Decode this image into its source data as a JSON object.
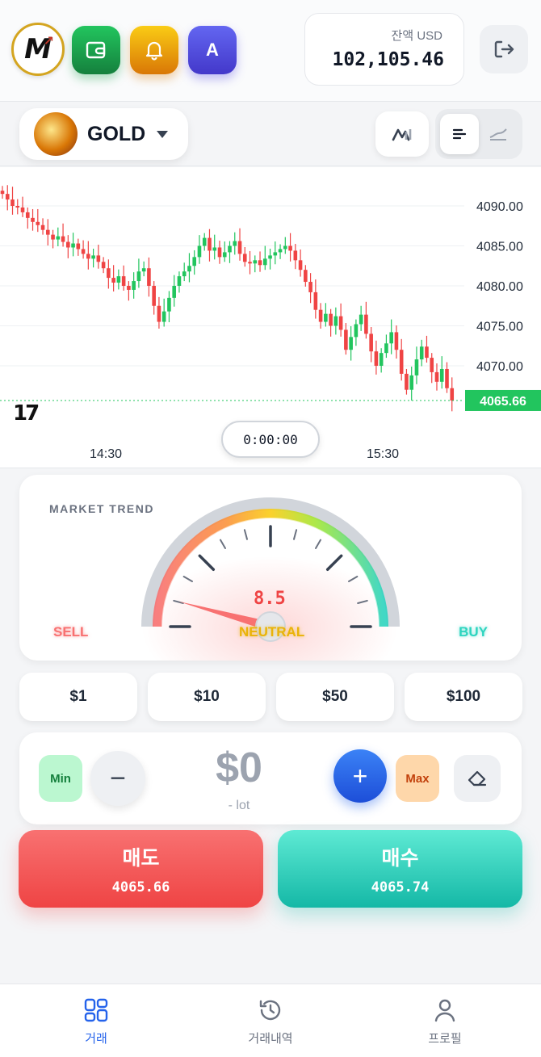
{
  "header": {
    "logo_text": "M",
    "avatar_letter": "A",
    "balance_label": "잔액 USD",
    "balance_value": "102,105.46"
  },
  "symbol": {
    "name": "GOLD"
  },
  "chart_data": {
    "type": "candlestick",
    "title": "",
    "y_ticks": [
      "4090.00",
      "4085.00",
      "4080.00",
      "4075.00",
      "4070.00"
    ],
    "x_ticks": [
      "14:30",
      "15:30"
    ],
    "ylim": [
      4062,
      4092
    ],
    "current_price": "4065.66",
    "close_series": [
      4091.5,
      4090.8,
      4090.0,
      4089.8,
      4089.2,
      4088.5,
      4088.0,
      4087.6,
      4087.0,
      4086.4,
      4085.8,
      4086.2,
      4085.5,
      4084.8,
      4085.3,
      4084.6,
      4084.0,
      4083.4,
      4083.8,
      4083.0,
      4082.2,
      4081.0,
      4080.4,
      4081.2,
      4080.0,
      4079.5,
      4080.6,
      4081.8,
      4082.2,
      4080.0,
      4077.5,
      4075.5,
      4076.8,
      4078.5,
      4080.0,
      4081.2,
      4081.8,
      4082.5,
      4083.6,
      4085.0,
      4086.0,
      4084.4,
      4084.8,
      4083.6,
      4084.2,
      4085.0,
      4085.6,
      4084.0,
      4083.0,
      4082.8,
      4083.2,
      4082.6,
      4083.4,
      4083.8,
      4084.2,
      4084.6,
      4085.0,
      4084.4,
      4083.2,
      4082.0,
      4080.5,
      4079.2,
      4077.0,
      4075.5,
      4076.5,
      4075.0,
      4076.2,
      4074.5,
      4072.0,
      4073.6,
      4075.2,
      4076.4,
      4074.0,
      4071.8,
      4070.0,
      4071.6,
      4072.8,
      4074.2,
      4072.0,
      4069.0,
      4067.0,
      4068.8,
      4070.8,
      4072.4,
      4071.0,
      4069.2,
      4068.0,
      4069.6,
      4067.2,
      4065.66
    ],
    "up_color": "#22c55e",
    "down_color": "#ef4444",
    "grid": true
  },
  "timer": "0:00:00",
  "trend": {
    "title": "MARKET TREND",
    "sell": "SELL",
    "neutral": "NEUTRAL",
    "buy": "BUY",
    "score": "8.5",
    "score_value": 8.5
  },
  "presets": [
    "$1",
    "$10",
    "$50",
    "$100"
  ],
  "lot": {
    "min": "Min",
    "max": "Max",
    "amount": "$0",
    "unit": "- lot"
  },
  "trade": {
    "sell_label": "매도",
    "sell_price": "4065.66",
    "buy_label": "매수",
    "buy_price": "4065.74"
  },
  "nav": [
    "거래",
    "거래내역",
    "프로필"
  ],
  "colors": {
    "accent_blue": "#2563eb",
    "sell_red": "#ef4444",
    "buy_teal": "#14b8a6",
    "price_green": "#22c55e"
  }
}
